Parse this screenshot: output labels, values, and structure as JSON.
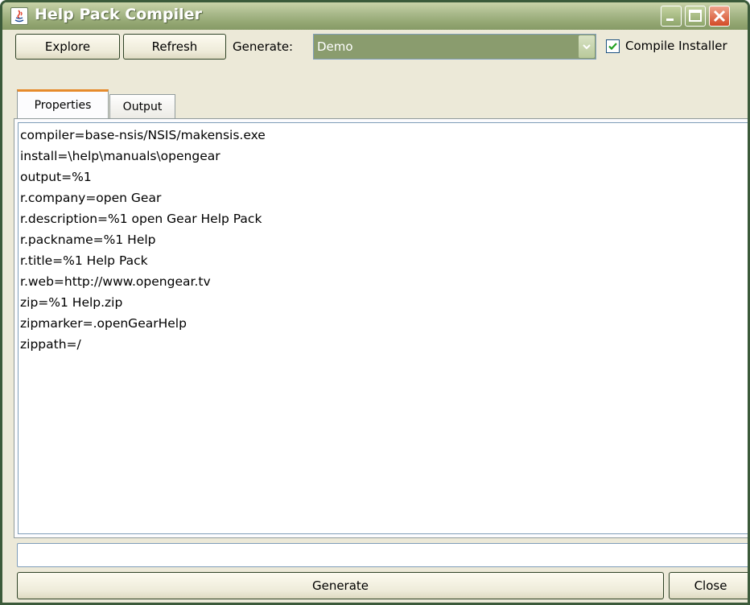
{
  "window": {
    "title": "Help Pack Compiler"
  },
  "toolbar": {
    "explore_label": "Explore",
    "refresh_label": "Refresh",
    "generate_label": "Generate:",
    "generate_value": "Demo",
    "compile_installer_label": "Compile Installer",
    "compile_installer_checked": true
  },
  "tabs": [
    {
      "label": "Properties",
      "active": true
    },
    {
      "label": "Output",
      "active": false
    }
  ],
  "properties": {
    "lines": [
      "compiler=base-nsis/NSIS/makensis.exe",
      "install=\\help\\manuals\\opengear",
      "output=%1",
      "r.company=open Gear",
      "r.description=%1 open Gear Help Pack",
      "r.packname=%1 Help",
      "r.title=%1 Help Pack",
      "r.web=http://www.opengear.tv",
      "zip=%1 Help.zip",
      "zipmarker=.openGearHelp",
      "zippath=/"
    ]
  },
  "status": {
    "value": ""
  },
  "footer": {
    "generate_label": "Generate",
    "close_label": "Close"
  },
  "colors": {
    "titlebar": "#93a672",
    "combo_bg": "#8a9c6e",
    "tab_accent": "#e68b2c",
    "close_button": "#d24a26"
  }
}
